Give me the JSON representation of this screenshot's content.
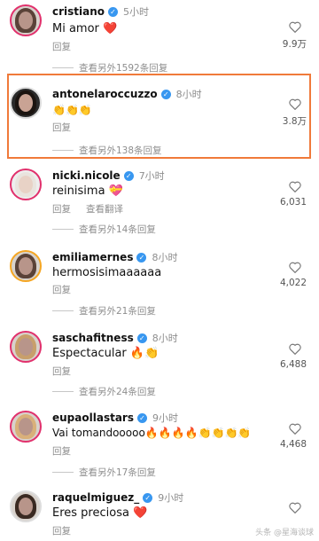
{
  "labels": {
    "reply": "回复",
    "translate": "查看翻译"
  },
  "colors": {
    "accent": "#3897f0",
    "highlight": "#f07a3a",
    "heart": "#e0245e",
    "muted": "#8e8e8e"
  },
  "icons": {
    "verified": "verified-badge-icon",
    "like": "heart-outline-icon"
  },
  "comments": [
    {
      "username": "cristiano",
      "verified": true,
      "time": "5小时",
      "text": "Mi amor ❤️",
      "likes": "9.9万",
      "more_replies": "查看另外1592条回复",
      "show_translate": false
    },
    {
      "username": "antonelaroccuzzo",
      "verified": true,
      "time": "8小时",
      "text": "👏👏👏",
      "likes": "3.8万",
      "more_replies": "查看另外138条回复",
      "show_translate": false
    },
    {
      "username": "nicki.nicole",
      "verified": true,
      "time": "7小时",
      "text": "reinisima 💝",
      "likes": "6,031",
      "more_replies": "查看另外14条回复",
      "show_translate": true
    },
    {
      "username": "emiliamernes",
      "verified": true,
      "time": "8小时",
      "text": "hermosisimaaaaaa",
      "likes": "4,022",
      "more_replies": "查看另外21条回复",
      "show_translate": false
    },
    {
      "username": "saschafitness",
      "verified": true,
      "time": "8小时",
      "text": "Espectacular 🔥👏",
      "likes": "6,488",
      "more_replies": "查看另外24条回复",
      "show_translate": false
    },
    {
      "username": "eupaollastars",
      "verified": true,
      "time": "9小时",
      "text": "Vai tomandooooo🔥🔥🔥🔥👏👏👏👏",
      "likes": "4,468",
      "more_replies": "查看另外17条回复",
      "show_translate": false
    },
    {
      "username": "raquelmiguez_",
      "verified": true,
      "time": "9小时",
      "text": "Eres preciosa ❤️",
      "likes": "",
      "more_replies": "",
      "show_translate": false
    }
  ],
  "watermark": "头条 @星海谈球"
}
